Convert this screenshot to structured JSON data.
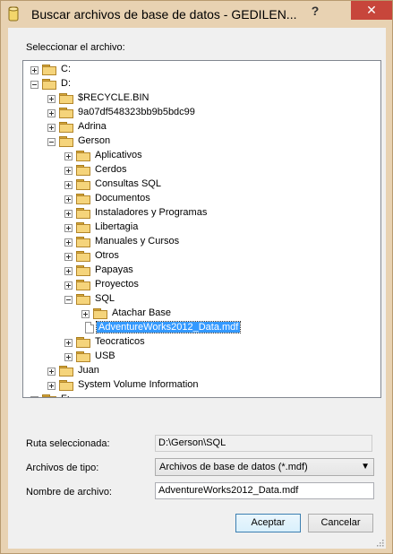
{
  "window": {
    "title": "Buscar archivos de base de datos - GEDILEN...",
    "help": "?",
    "close": "✕"
  },
  "select_file_label": "Seleccionar el archivo:",
  "tree": [
    {
      "label": "C:",
      "level": 0,
      "type": "folder",
      "expander": "plus"
    },
    {
      "label": "D:",
      "level": 0,
      "type": "folder",
      "expander": "minus"
    },
    {
      "label": "$RECYCLE.BIN",
      "level": 1,
      "type": "folder",
      "expander": "plus"
    },
    {
      "label": "9a07df548323bb9b5bdc99",
      "level": 1,
      "type": "folder",
      "expander": "plus"
    },
    {
      "label": "Adrina",
      "level": 1,
      "type": "folder",
      "expander": "plus"
    },
    {
      "label": "Gerson",
      "level": 1,
      "type": "folder",
      "expander": "minus"
    },
    {
      "label": "Aplicativos",
      "level": 2,
      "type": "folder",
      "expander": "plus"
    },
    {
      "label": "Cerdos",
      "level": 2,
      "type": "folder",
      "expander": "plus"
    },
    {
      "label": "Consultas SQL",
      "level": 2,
      "type": "folder",
      "expander": "plus"
    },
    {
      "label": "Documentos",
      "level": 2,
      "type": "folder",
      "expander": "plus"
    },
    {
      "label": "Instaladores y Programas",
      "level": 2,
      "type": "folder",
      "expander": "plus"
    },
    {
      "label": "Libertagia",
      "level": 2,
      "type": "folder",
      "expander": "plus"
    },
    {
      "label": "Manuales y Cursos",
      "level": 2,
      "type": "folder",
      "expander": "plus"
    },
    {
      "label": "Otros",
      "level": 2,
      "type": "folder",
      "expander": "plus"
    },
    {
      "label": "Papayas",
      "level": 2,
      "type": "folder",
      "expander": "plus"
    },
    {
      "label": "Proyectos",
      "level": 2,
      "type": "folder",
      "expander": "plus"
    },
    {
      "label": "SQL",
      "level": 2,
      "type": "folder",
      "expander": "minus"
    },
    {
      "label": "Atachar Base",
      "level": 3,
      "type": "folder",
      "expander": "plus"
    },
    {
      "label": "AdventureWorks2012_Data.mdf",
      "level": 3,
      "type": "file",
      "expander": "none",
      "selected": true
    },
    {
      "label": "Teocraticos",
      "level": 2,
      "type": "folder",
      "expander": "plus"
    },
    {
      "label": "USB",
      "level": 2,
      "type": "folder",
      "expander": "plus"
    },
    {
      "label": "Juan",
      "level": 1,
      "type": "folder",
      "expander": "plus"
    },
    {
      "label": "System Volume Information",
      "level": 1,
      "type": "folder",
      "expander": "plus"
    },
    {
      "label": "F:",
      "level": 0,
      "type": "folder",
      "expander": "plus"
    }
  ],
  "selected_path": {
    "label": "Ruta seleccionada:",
    "value": "D:\\Gerson\\SQL"
  },
  "file_type": {
    "label": "Archivos de tipo:",
    "value": "Archivos de base de datos (*.mdf)"
  },
  "file_name": {
    "label": "Nombre de archivo:",
    "value": "AdventureWorks2012_Data.mdf"
  },
  "buttons": {
    "accept": "Aceptar",
    "cancel": "Cancelar"
  },
  "colors": {
    "selection": "#3399ff",
    "frame": "#e8d2b2",
    "close": "#c7463b"
  }
}
